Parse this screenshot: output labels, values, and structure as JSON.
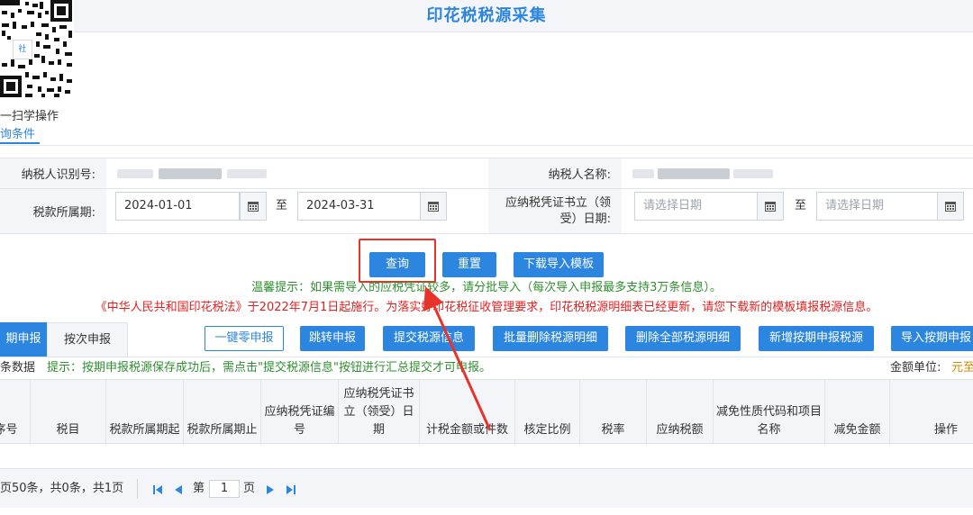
{
  "header": {
    "title": "印花税税源采集"
  },
  "qr": {
    "logo_text": "社",
    "scan_text": "一扫学操作"
  },
  "query_tab": {
    "label": "询条件"
  },
  "form": {
    "taxpayer_id_label": "纳税人识别号:",
    "taxpayer_name_label": "纳税人名称:",
    "tax_period_label": "税款所属期:",
    "period_start": "2024-01-01",
    "to_1": "至",
    "period_end": "2024-03-31",
    "voucher_date_label": "应纳税凭证书立（领受）日期:",
    "voucher_start_placeholder": "请选择日期",
    "to_2": "至",
    "voucher_end_placeholder": "请选择日期"
  },
  "buttons": {
    "query": "查询",
    "reset": "重置",
    "download_template": "下载导入模板"
  },
  "tips": {
    "green": "温馨提示：如果需导入的应税凭证较多，请分批导入（每次导入申报最多支持3万条信息）。",
    "red": "《中华人民共和国印花税法》于2022年7月1日起施行。为落实好印花税征收管理要求，印花税税源明细表已经更新，请您下载新的模板填报税源信息。"
  },
  "tabs": [
    {
      "label": "期申报"
    },
    {
      "label": "按次申报"
    }
  ],
  "actions": {
    "zero": "一键零申报",
    "jump": "跳转申报",
    "submit": "提交税源信息",
    "batch_delete": "批量删除税源明细",
    "delete_all": "删除全部税源明细",
    "add_period": "新增按期申报税源",
    "import_period": "导入按期申报"
  },
  "note": {
    "prefix": "条数据",
    "hint": "提示：按期申报税源保存成功后，需点击\"提交税源信息\"按钮进行汇总提交才可申报。",
    "unit_label": "金额单位:",
    "unit_value": "元至"
  },
  "table": {
    "headers": [
      "序号",
      "税目",
      "税款所属期起",
      "税款所属期止",
      "应纳税凭证编号",
      "应纳税凭证书立（领受）日期",
      "计税金额或件数",
      "核定比例",
      "税率",
      "应纳税额",
      "减免性质代码和项目名称",
      "减免金额",
      "操作"
    ]
  },
  "pager": {
    "summary": "页50条，共0条，共1页",
    "page_prefix": "第",
    "page_value": "1",
    "page_suffix": "页"
  },
  "colors": {
    "accent": "#2c86e0",
    "highlight": "#e8332b",
    "tip_green": "#2f8f2f",
    "tip_red": "#e02020"
  }
}
